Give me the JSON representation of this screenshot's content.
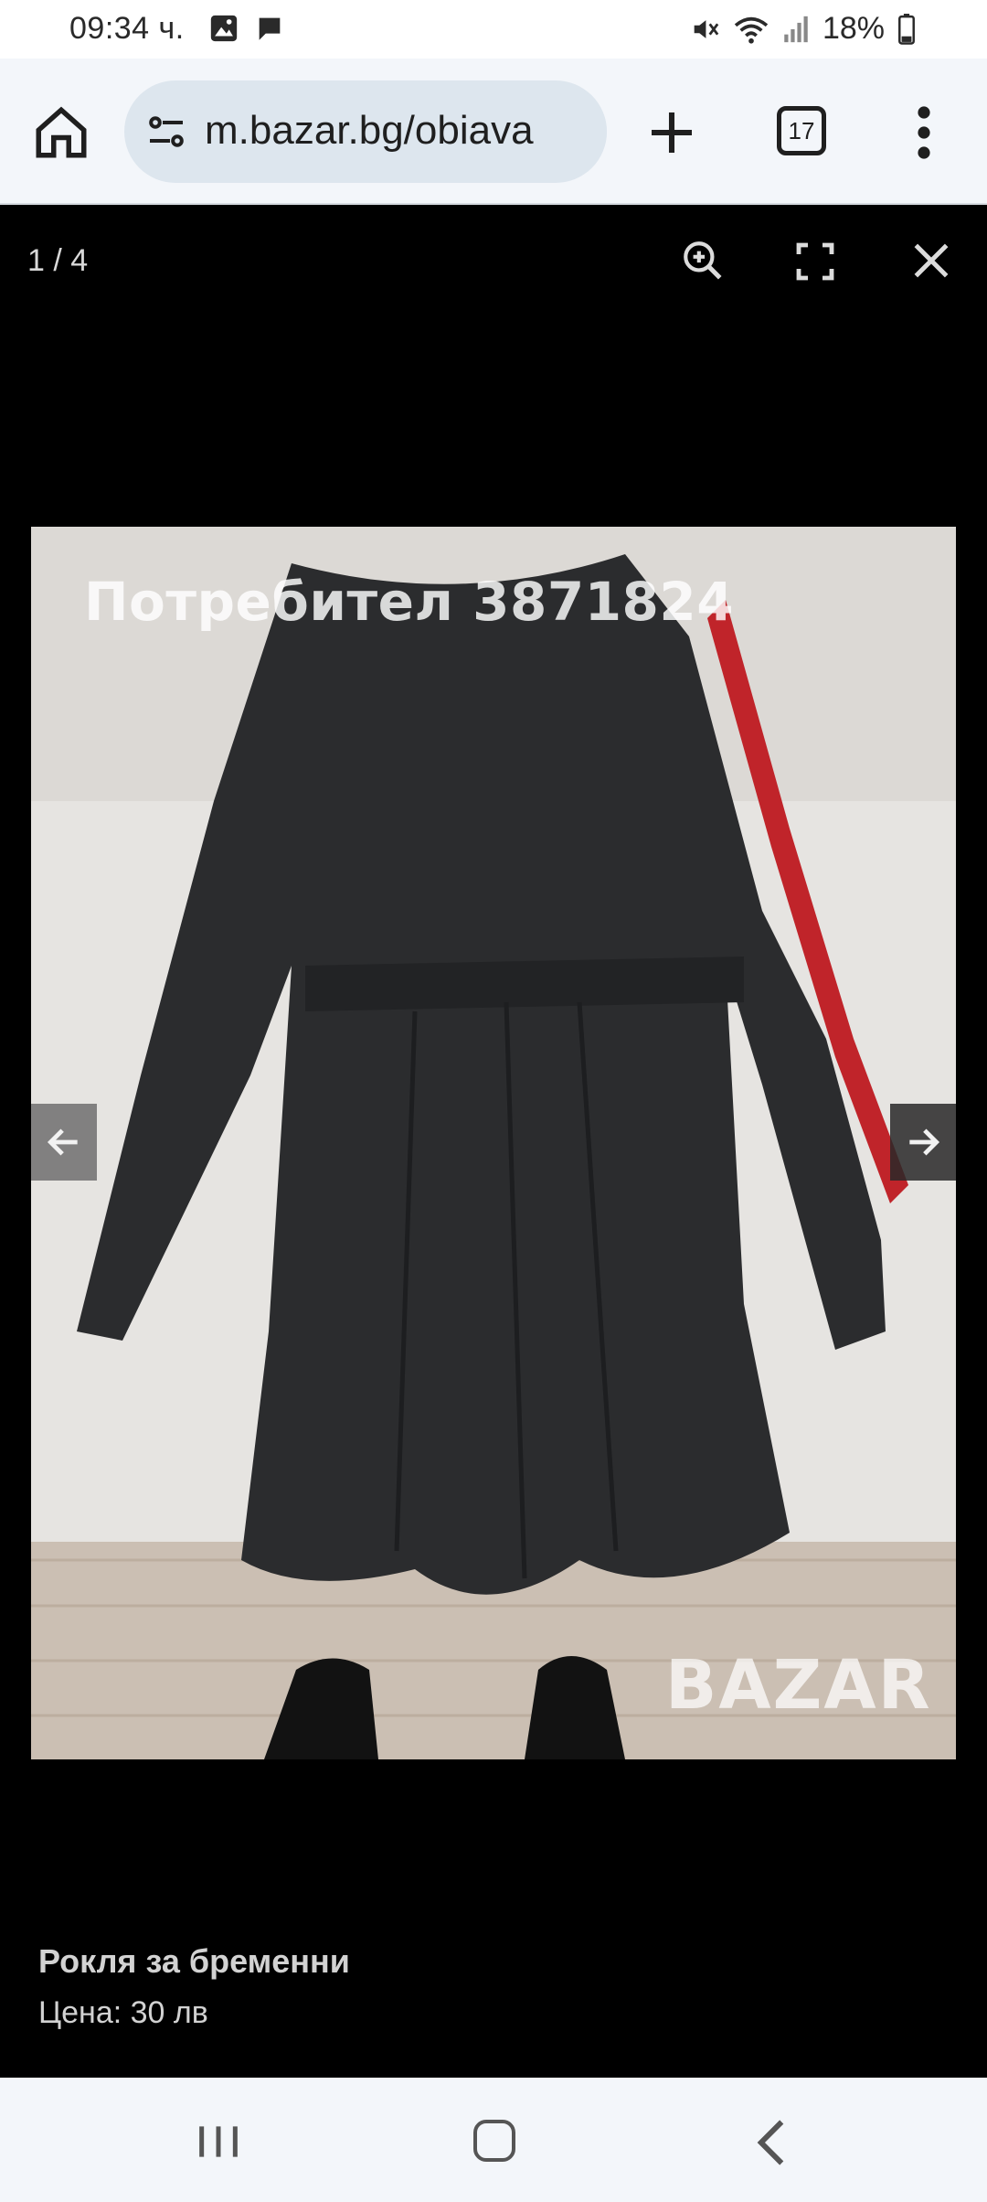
{
  "status_bar": {
    "time": "09:34 ч.",
    "battery": "18%",
    "icons": [
      "gallery-icon",
      "chat-bubble-icon",
      "mute-icon",
      "wifi-icon",
      "signal-icon",
      "battery-icon"
    ]
  },
  "browser": {
    "url": "m.bazar.bg/obiava",
    "tab_count": "17",
    "icons": [
      "home-icon",
      "site-settings-icon",
      "plus-icon",
      "tab-switcher-icon",
      "more-vert-icon"
    ]
  },
  "gallery": {
    "counter": "1 / 4",
    "icons": [
      "zoom-in-icon",
      "fullscreen-icon",
      "close-icon",
      "arrow-left-icon",
      "arrow-right-icon"
    ],
    "photo_caption": "Потребител 3871824",
    "photo_logo": "BAZAR"
  },
  "listing": {
    "title": "Рокля за бременни",
    "price": "Цена: 30 лв"
  },
  "colors": {
    "status_bg": "#ffffff",
    "toolbar_bg": "#f3f6fa",
    "url_pill_bg": "#dde6ee",
    "viewer_bg": "#000000",
    "text_light": "#d2d2d2"
  }
}
